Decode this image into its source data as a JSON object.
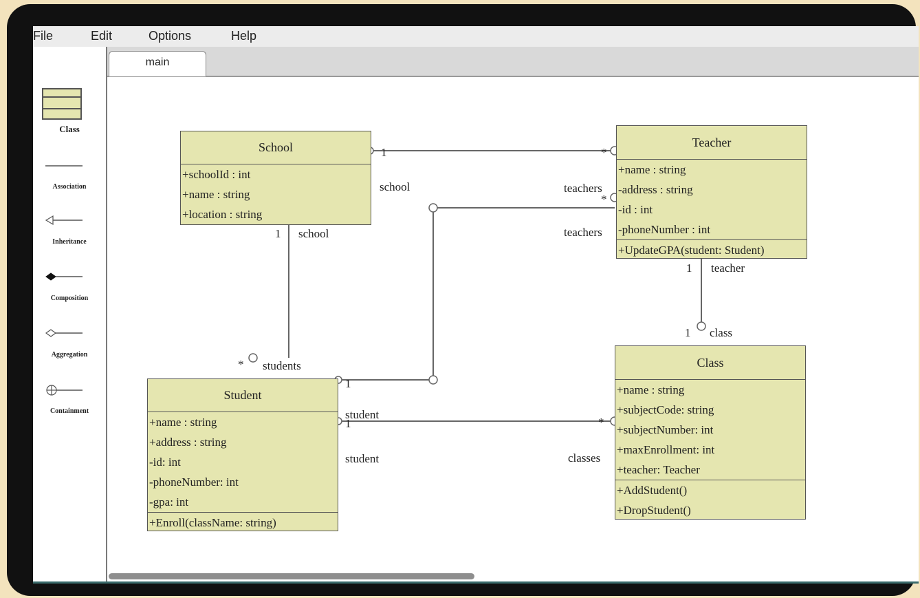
{
  "menu": [
    "File",
    "Edit",
    "Options",
    "Help"
  ],
  "tab": "main",
  "palette": [
    {
      "label": "Class",
      "icon": "class-icon"
    },
    {
      "label": "Association",
      "icon": "association-line-icon"
    },
    {
      "label": "Inheritance",
      "icon": "inheritance-arrow-icon"
    },
    {
      "label": "Composition",
      "icon": "composition-diamond-icon"
    },
    {
      "label": "Aggregation",
      "icon": "aggregation-diamond-icon"
    },
    {
      "label": "Containment",
      "icon": "containment-circle-icon"
    }
  ],
  "classes": {
    "school": {
      "name": "School",
      "attributes": [
        "+schoolId : int",
        "+name : string",
        "+location : string"
      ],
      "methods": []
    },
    "teacher": {
      "name": "Teacher",
      "attributes": [
        "+name : string",
        "-address : string",
        "-id : int",
        "-phoneNumber : int"
      ],
      "methods": [
        "+UpdateGPA(student: Student)"
      ]
    },
    "student": {
      "name": "Student",
      "attributes": [
        "+name : string",
        "+address : string",
        "-id: int",
        "-phoneNumber: int",
        "-gpa: int"
      ],
      "methods": [
        "+Enroll(className: string)"
      ]
    },
    "class": {
      "name": "Class",
      "attributes": [
        "+name : string",
        "+subjectCode: string",
        "+subjectNumber: int",
        "+maxEnrollment: int",
        "+teacher: Teacher"
      ],
      "methods": [
        "+AddStudent()",
        "+DropStudent()"
      ]
    }
  },
  "labels": {
    "school_teacher_mult_school": "1",
    "school_teacher_role_school": "school",
    "school_teacher_mult_teacher": "*",
    "school_teacher_role_teacher": "teachers",
    "student_teacher_mult_teacher": "*",
    "student_teacher_role_teacher": "teachers",
    "school_student_mult_school": "1",
    "school_student_role_school": "school",
    "school_student_mult_student": "*",
    "school_student_role_student": "students",
    "student_teacher_mult_student": "1",
    "student_teacher_role_student": "student",
    "student_class_mult_student": "1",
    "student_class_role_student": "student",
    "student_class_mult_class": "*",
    "student_class_role_class": "classes",
    "teacher_class_mult_teacher": "1",
    "teacher_class_role_teacher": "teacher",
    "teacher_class_mult_class": "1",
    "teacher_class_role_class": "class"
  }
}
